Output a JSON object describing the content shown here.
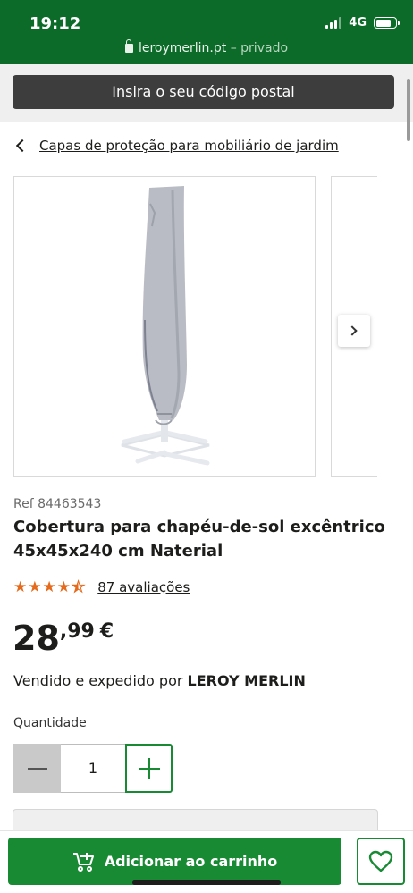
{
  "status_bar": {
    "time": "19:12",
    "network": "4G"
  },
  "browser": {
    "domain": "leroymerlin.pt",
    "mode": "– privado"
  },
  "header": {
    "zip_button": "Insira o seu código postal"
  },
  "breadcrumb": {
    "label": "Capas de proteção para mobiliário de jardim"
  },
  "product": {
    "ref": "Ref 84463543",
    "title": "Cobertura para chapéu-de-sol excêntrico 45x45x240 cm Naterial",
    "rating": {
      "stars": 4.5,
      "max": 5,
      "reviews": "87 avaliações"
    },
    "price": {
      "integer": "28",
      "decimals": ",99",
      "currency": "€"
    },
    "seller_prefix": "Vendido e expedido por ",
    "seller_name": "LEROY MERLIN"
  },
  "quantity": {
    "label": "Quantidade",
    "value": "1"
  },
  "actions": {
    "add_to_cart": "Adicionar ao carrinho"
  },
  "colors": {
    "brand_green": "#188a34",
    "header_green": "#0d6b2a",
    "star_orange": "#e56a1b"
  }
}
